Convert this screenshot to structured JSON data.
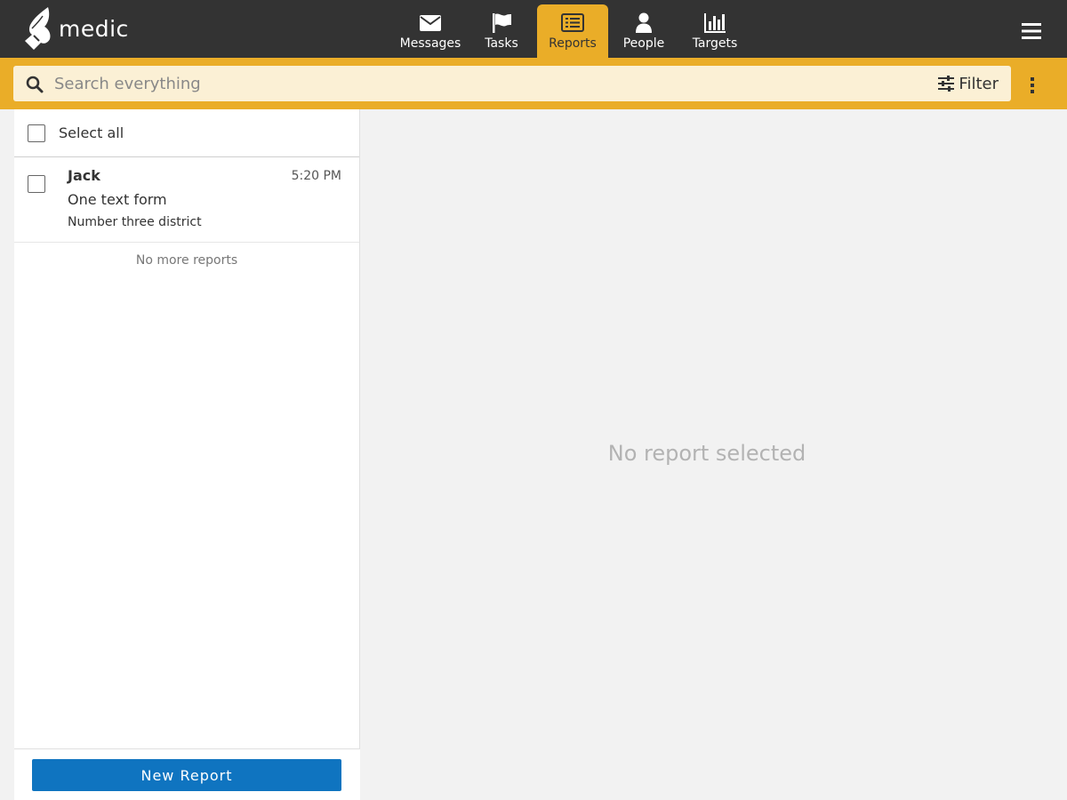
{
  "header": {
    "logo_text": "medic",
    "nav": [
      {
        "label": "Messages",
        "icon": "envelope-icon"
      },
      {
        "label": "Tasks",
        "icon": "flag-icon"
      },
      {
        "label": "Reports",
        "icon": "list-alt-icon",
        "active": true
      },
      {
        "label": "People",
        "icon": "user-icon"
      },
      {
        "label": "Targets",
        "icon": "bar-chart-icon"
      }
    ],
    "accent_color": "#eaad28",
    "bar_color": "#333333"
  },
  "search": {
    "placeholder": "Search everything",
    "value": "",
    "filter_label": "Filter"
  },
  "list": {
    "select_all_label": "Select all",
    "reports": [
      {
        "name": "Jack",
        "time": "5:20 PM",
        "form": "One text form",
        "place": "Number three district"
      }
    ],
    "no_more_label": "No more reports",
    "new_report_label": "New Report"
  },
  "detail": {
    "empty_label": "No report selected"
  }
}
